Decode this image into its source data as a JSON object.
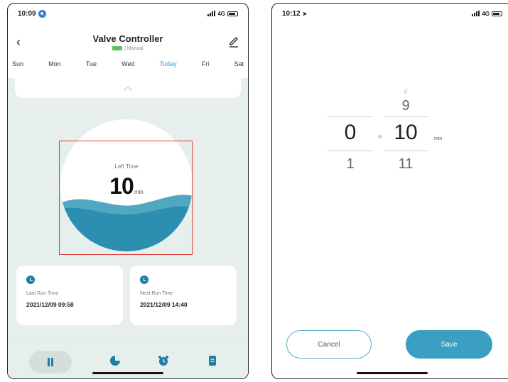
{
  "left_screen": {
    "status_time": "10:09",
    "status_net": "4G",
    "title": "Valve Controller",
    "subtitle": "| Manual",
    "days": [
      "Sun",
      "Mon",
      "Tue",
      "Wed",
      "Today",
      "Fri",
      "Sat"
    ],
    "active_day": "Today",
    "gauge": {
      "label": "Left Time",
      "value": "10",
      "unit": "min"
    },
    "last_run": {
      "label": "Last Run Time",
      "value": "2021/12/09 09:58"
    },
    "next_run": {
      "label": "Next Run Time",
      "value": "2021/12/09 14:40"
    }
  },
  "right_screen": {
    "status_time": "10:12",
    "status_net": "4G",
    "picker": {
      "hours": {
        "above": "",
        "selected": "0",
        "below": "1",
        "unit": "h"
      },
      "minutes": {
        "above_faint": "8",
        "above": "9",
        "selected": "10",
        "below": "11",
        "unit": "min"
      }
    },
    "cancel_label": "Cancel",
    "save_label": "Save"
  },
  "colors": {
    "accent": "#3a9fc0",
    "highlight": "#e0393c",
    "background": "#e6efec"
  }
}
